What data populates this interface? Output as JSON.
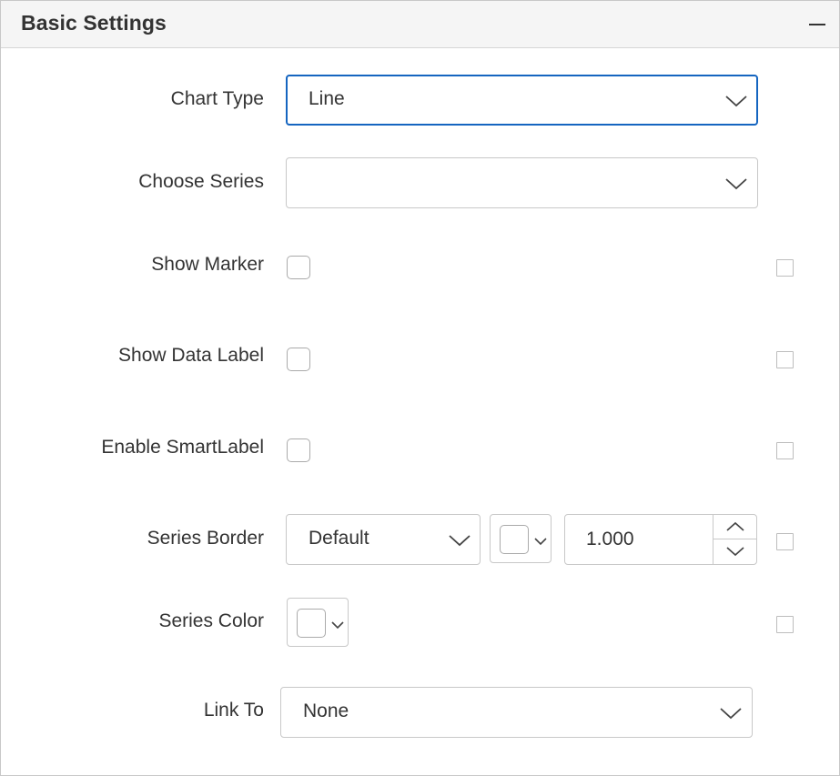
{
  "header": {
    "title": "Basic Settings"
  },
  "fields": {
    "chart_type": {
      "label": "Chart Type",
      "value": "Line"
    },
    "choose_series": {
      "label": "Choose Series",
      "value": ""
    },
    "show_marker": {
      "label": "Show Marker",
      "checked": false
    },
    "show_data_label": {
      "label": "Show Data Label",
      "checked": false
    },
    "enable_smart_label": {
      "label": "Enable SmartLabel",
      "checked": false
    },
    "series_border": {
      "label": "Series Border",
      "style": "Default",
      "color": "#ffffff",
      "width": "1.000"
    },
    "series_color": {
      "label": "Series Color",
      "color": "#ffffff"
    },
    "link_to": {
      "label": "Link To",
      "value": "None"
    }
  },
  "colors": {
    "focus_border": "#1565c0",
    "border": "#c8c8c8",
    "text": "#333333",
    "header_bg": "#f5f5f5"
  },
  "icons": [
    "minus-icon",
    "chevron-down-icon",
    "chevron-up-icon"
  ]
}
